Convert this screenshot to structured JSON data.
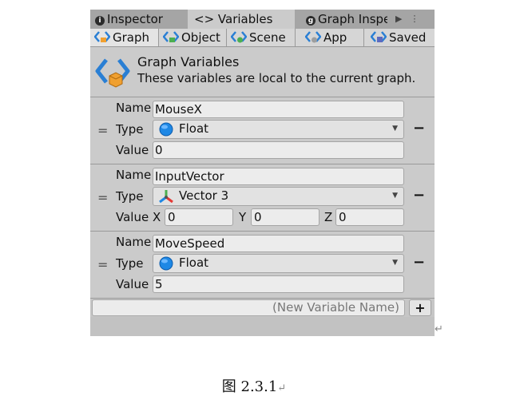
{
  "window_tabs": [
    {
      "label": "Inspector",
      "icon": "info-icon"
    },
    {
      "label": "<> Variables",
      "icon": "variables-icon"
    },
    {
      "label": "Graph Inspe",
      "icon": "graph-inspector-icon"
    }
  ],
  "scope_tabs": [
    {
      "label": "Graph",
      "active": true
    },
    {
      "label": "Object",
      "active": false
    },
    {
      "label": "Scene",
      "active": false
    },
    {
      "label": "App",
      "active": false
    },
    {
      "label": "Saved",
      "active": false
    }
  ],
  "header": {
    "title": "Graph Variables",
    "description": "These variables are local to the current graph."
  },
  "labels": {
    "name": "Name",
    "type": "Type",
    "value": "Value"
  },
  "variables": [
    {
      "name": "MouseX",
      "type": "Float",
      "value": "0"
    },
    {
      "name": "InputVector",
      "type": "Vector 3",
      "x_label": "X",
      "x": "0",
      "y_label": "Y",
      "y": "0",
      "z_label": "Z",
      "z": "0"
    },
    {
      "name": "MoveSpeed",
      "type": "Float",
      "value": "5"
    }
  ],
  "new_variable_placeholder": "(New Variable Name)",
  "add_button": "+",
  "remove_button": "−",
  "handle": "=",
  "caption": "图 2.3.1",
  "colors": {
    "panel": "#c2c2c2",
    "float_icon": "#1e88e5"
  }
}
